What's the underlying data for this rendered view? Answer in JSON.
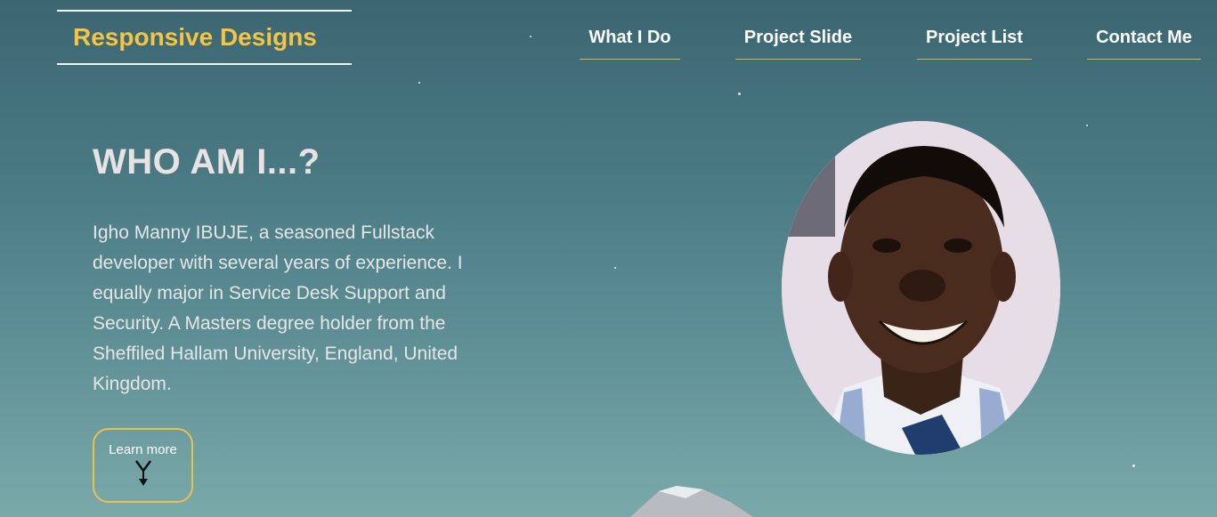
{
  "logo": {
    "text": "Responsive Designs"
  },
  "nav": {
    "items": [
      {
        "label": "What I Do"
      },
      {
        "label": "Project Slide"
      },
      {
        "label": "Project List"
      },
      {
        "label": "Contact Me"
      }
    ]
  },
  "hero": {
    "heading": "WHO AM I...?",
    "bio": "Igho Manny IBUJE, a seasoned Fullstack developer with several years of experience. I equally major in Service Desk Support and Security. A Masters degree holder from the Sheffiled Hallam University, England, United Kingdom.",
    "button_label": "Learn more",
    "button_icon": "double-chevron-down-arrow",
    "portrait": "profile-photo"
  },
  "colors": {
    "accent": "#f6c443",
    "nav_underline": "#d8b54a",
    "button_border": "#e9c24a",
    "heading": "#e9e2e2"
  }
}
